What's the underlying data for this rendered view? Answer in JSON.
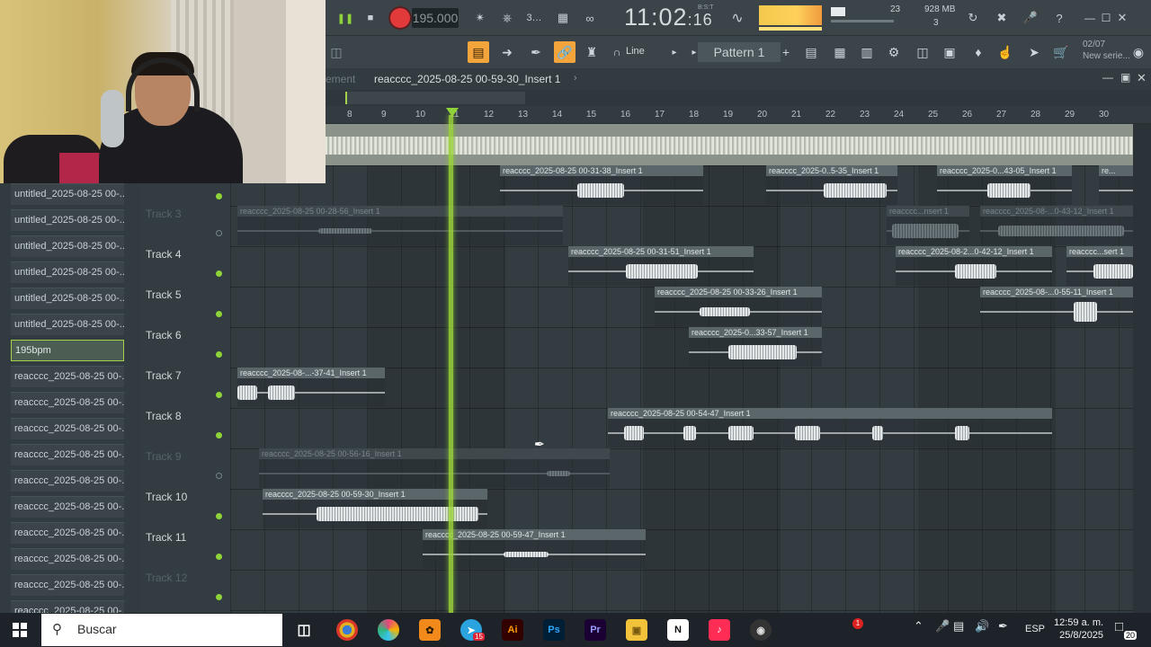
{
  "toolbar": {
    "tempo": "195.000",
    "time_main": "11:02",
    "time_sub": ":16",
    "time_label": "B:S:T",
    "cpu": "23",
    "ram_mb": "928 MB",
    "ram_voices": "3"
  },
  "toolbar2": {
    "snap_mode": "Line",
    "pattern": "Pattern 1",
    "news_date": "02/07",
    "news_text": "New serie..."
  },
  "playlist": {
    "faded_title": "ement",
    "title": "reacccc_2025-08-25 00-59-30_Insert 1"
  },
  "ruler": [
    "8",
    "9",
    "10",
    "11",
    "12",
    "13",
    "14",
    "15",
    "16",
    "17",
    "18",
    "19",
    "20",
    "21",
    "22",
    "23",
    "24",
    "25",
    "26",
    "27",
    "28",
    "29",
    "30"
  ],
  "browser": {
    "items": [
      {
        "label": "untitled_2025-08-25 00-..."
      },
      {
        "label": "untitled_2025-08-25 00-..."
      },
      {
        "label": "untitled_2025-08-25 00-..."
      },
      {
        "label": "untitled_2025-08-25 00-..."
      },
      {
        "label": "untitled_2025-08-25 00-..."
      },
      {
        "label": "untitled_2025-08-25 00-..."
      },
      {
        "label": "195bpm"
      },
      {
        "label": "reacccc_2025-08-25 00-..."
      },
      {
        "label": "reacccc_2025-08-25 00-..."
      },
      {
        "label": "reacccc_2025-08-25 00-..."
      },
      {
        "label": "reacccc_2025-08-25 00-..."
      },
      {
        "label": "reacccc_2025-08-25 00-..."
      },
      {
        "label": "reacccc_2025-08-25 00-..."
      },
      {
        "label": "reacccc_2025-08-25 00-..."
      },
      {
        "label": "reacccc_2025-08-25 00-..."
      },
      {
        "label": "reacccc_2025-08-25 00-..."
      },
      {
        "label": "reacccc_2025-08-25 00-..."
      }
    ]
  },
  "tracks": [
    {
      "name": "Track 3"
    },
    {
      "name": "Track 4"
    },
    {
      "name": "Track 5"
    },
    {
      "name": "Track 6"
    },
    {
      "name": "Track 7"
    },
    {
      "name": "Track 8"
    },
    {
      "name": "Track 9"
    },
    {
      "name": "Track 10"
    },
    {
      "name": "Track 11"
    },
    {
      "name": "Track 12"
    }
  ],
  "clips": {
    "c1": "reacccc_2025-08-25 00-31-38_Insert 1",
    "c2": "reacccc_2025-0..5-35_Insert 1",
    "c3": "reacccc_2025-0...43-05_Insert 1",
    "c4": "re...",
    "c5": "reacccc_2025-08-25 00-28-56_Insert 1",
    "c6": "reacccc...nsert 1",
    "c7": "reacccc_2025-08-...0-43-12_Insert 1",
    "c8": "reacccc_2025-08-25 00-31-51_Insert 1",
    "c9": "reacccc_2025-08-2...0-42-12_Insert 1",
    "c10": "reacccc...sert 1",
    "c11": "reacccc_2025-08-25 00-33-26_Insert 1",
    "c12": "reacccc_2025-08-...0-55-11_Insert 1",
    "c13": "reacccc_2025-0...33-57_Insert 1",
    "c14": "reacccc_2025-08-...-37-41_Insert 1",
    "c15": "reacccc_2025-08-25 00-54-47_Insert 1",
    "c16": "reacccc_2025-08-25 00-56-16_Insert 1",
    "c17": "reacccc_2025-08-25 00-59-30_Insert 1",
    "c18": "reacccc_2025-08-25 00-59-47_Insert 1"
  },
  "taskbar": {
    "search_placeholder": "Buscar",
    "language": "ESP",
    "time": "12:59 a. m.",
    "date": "25/8/2025",
    "notifications": "20",
    "telegram_badge": "15",
    "chrome_badge": "1"
  }
}
